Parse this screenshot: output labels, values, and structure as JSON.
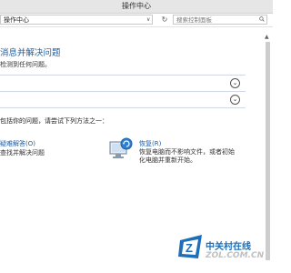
{
  "window": {
    "title": "操作中心"
  },
  "addressbar": {
    "path": "操作中心",
    "dropdown_glyph": "∨",
    "refresh_glyph": "↻",
    "search_placeholder": "搜索控制面板"
  },
  "main": {
    "title": "消息并解决问题",
    "subtitle": "检测到任何问题。",
    "sections": [
      {
        "expand_glyph": "⌄"
      },
      {
        "expand_glyph": "⌄"
      }
    ],
    "hint": "包括你的问题，请尝试下列方法之一：",
    "options": {
      "troubleshoot": {
        "title": "疑难解答(O)",
        "description": "查找并解决问题"
      },
      "recovery": {
        "title": "恢复(R)",
        "description": "恢复电脑而不影响文件，或者初始化电脑并重新开始。"
      }
    }
  },
  "watermark": {
    "brand": "中关村在线",
    "domain": "ZOL.COM.CN"
  },
  "colors": {
    "link_blue": "#1a5ea8",
    "titlebar": "#e6e6e6"
  }
}
